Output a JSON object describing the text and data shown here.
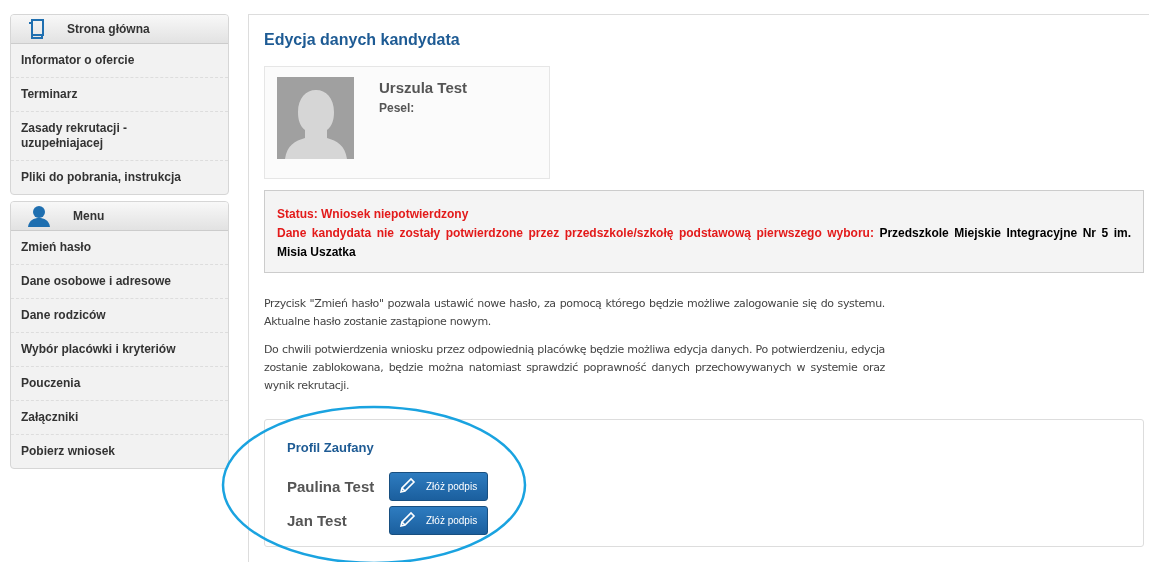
{
  "sidebar": {
    "sections": [
      {
        "title": "Strona główna",
        "kind": "document",
        "items": [
          "Informator o ofercie",
          "Terminarz",
          "Zasady rekrutacji - uzupełniajacej",
          "Pliki do pobrania, instrukcja"
        ]
      },
      {
        "title": "Menu",
        "kind": "person",
        "items": [
          "Zmień hasło",
          "Dane osobowe i adresowe",
          "Dane rodziców",
          "Wybór placówki i kryteriów",
          "Pouczenia",
          "Załączniki",
          "Pobierz wniosek"
        ]
      }
    ]
  },
  "main": {
    "title": "Edycja danych kandydata",
    "candidate": {
      "name": "Urszula Test",
      "pesel_label": "Pesel:"
    },
    "status": {
      "status_line": "Status: Wniosek niepotwierdzony",
      "message": "Dane kandydata nie zostały potwierdzone przez przedszkole/szkołę podstawową pierwszego wyboru:",
      "school": "Przedszkole Miejskie Integracyjne Nr 5 im. Misia Uszatka"
    },
    "paragraphs": [
      "Przycisk \"Zmień hasło\" pozwala ustawić nowe hasło, za pomocą którego będzie możliwe zalogowanie się do systemu. Aktualne hasło zostanie zastąpione nowym.",
      "Do chwili potwierdzenia wniosku przez odpowiednią placówkę będzie możliwa edycja danych. Po potwierdzeniu, edycja zostanie zablokowana, będzie można natomiast sprawdzić poprawność danych przechowywanych w systemie oraz wynik rekrutacji."
    ],
    "trusted_profile": {
      "title": "Profil Zaufany",
      "signers": [
        {
          "name": "Paulina Test",
          "button": "Złóż podpis"
        },
        {
          "name": "Jan Test",
          "button": "Złóż podpis"
        }
      ]
    }
  }
}
